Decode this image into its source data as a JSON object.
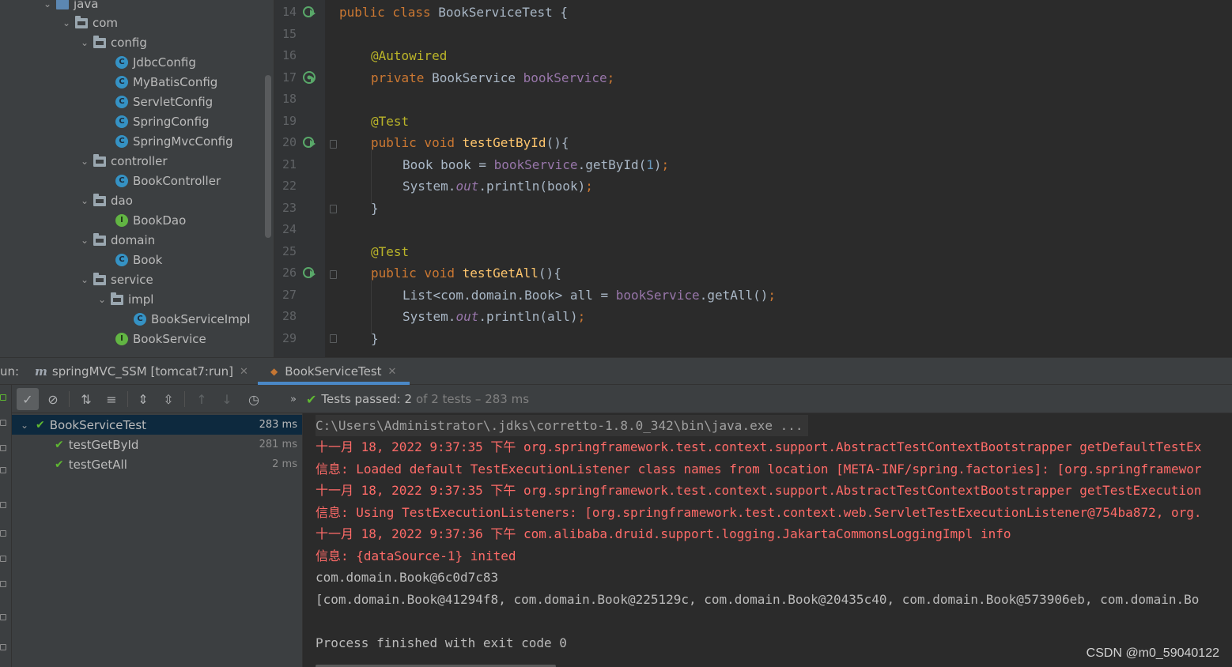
{
  "project_tree": {
    "items": [
      {
        "label": "java",
        "kind": "folder-src"
      },
      {
        "label": "com",
        "kind": "package"
      },
      {
        "label": "config",
        "kind": "package"
      },
      {
        "label": "JdbcConfig",
        "kind": "class"
      },
      {
        "label": "MyBatisConfig",
        "kind": "class"
      },
      {
        "label": "ServletConfig",
        "kind": "class"
      },
      {
        "label": "SpringConfig",
        "kind": "class"
      },
      {
        "label": "SpringMvcConfig",
        "kind": "class"
      },
      {
        "label": "controller",
        "kind": "package"
      },
      {
        "label": "BookController",
        "kind": "class"
      },
      {
        "label": "dao",
        "kind": "package"
      },
      {
        "label": "BookDao",
        "kind": "interface"
      },
      {
        "label": "domain",
        "kind": "package"
      },
      {
        "label": "Book",
        "kind": "class"
      },
      {
        "label": "service",
        "kind": "package"
      },
      {
        "label": "impl",
        "kind": "package"
      },
      {
        "label": "BookServiceImpl",
        "kind": "class"
      },
      {
        "label": "BookService",
        "kind": "interface"
      }
    ]
  },
  "editor": {
    "line_numbers": [
      "14",
      "15",
      "16",
      "17",
      "18",
      "19",
      "20",
      "21",
      "22",
      "23",
      "24",
      "25",
      "26",
      "27",
      "28",
      "29"
    ],
    "code": {
      "l14_kw": "public class ",
      "l14_name": "BookServiceTest {",
      "l16_ann": "@Autowired",
      "l17_kw": "private ",
      "l17_type": "BookService ",
      "l17_field": "bookService",
      "l17_semi": ";",
      "l19_ann": "@Test",
      "l20_kw": "public void ",
      "l20_fn": "testGetById",
      "l20_rest": "(){",
      "l21_a": "Book book = ",
      "l21_field": "bookService",
      "l21_b": ".getById(",
      "l21_num": "1",
      "l21_c": ")",
      "l21_semi": ";",
      "l22_a": "System.",
      "l22_out": "out",
      "l22_b": ".println(book)",
      "l22_semi": ";",
      "l23": "}",
      "l25_ann": "@Test",
      "l26_kw": "public void ",
      "l26_fn": "testGetAll",
      "l26_rest": "(){",
      "l27_a": "List<com.domain.Book> all = ",
      "l27_field": "bookService",
      "l27_b": ".getAll()",
      "l27_semi": ";",
      "l28_a": "System.",
      "l28_out": "out",
      "l28_b": ".println(all)",
      "l28_semi": ";",
      "l29": "}"
    }
  },
  "run_panel": {
    "label": "un:",
    "tabs": [
      {
        "label": "springMVC_SSM [tomcat7:run]",
        "icon": "maven-icon"
      },
      {
        "label": "BookServiceTest",
        "icon": "test-icon",
        "active": true
      }
    ],
    "status": {
      "main": "Tests passed: 2",
      "sub": "of 2 tests – 283 ms"
    },
    "tests": [
      {
        "name": "BookServiceTest",
        "duration": "283 ms",
        "selected": true
      },
      {
        "name": "testGetById",
        "duration": "281 ms"
      },
      {
        "name": "testGetAll",
        "duration": "2 ms"
      }
    ],
    "console": [
      {
        "text": "C:\\Users\\Administrator\\.jdks\\corretto-1.8.0_342\\bin\\java.exe ...",
        "kind": "cmd"
      },
      {
        "text": "十一月 18, 2022 9:37:35 下午 org.springframework.test.context.support.AbstractTestContextBootstrapper getDefaultTestEx",
        "kind": "err"
      },
      {
        "text": "信息: Loaded default TestExecutionListener class names from location [META-INF/spring.factories]: [org.springframewor",
        "kind": "err"
      },
      {
        "text": "十一月 18, 2022 9:37:35 下午 org.springframework.test.context.support.AbstractTestContextBootstrapper getTestExecution",
        "kind": "err"
      },
      {
        "text": "信息: Using TestExecutionListeners: [org.springframework.test.context.web.ServletTestExecutionListener@754ba872, org.",
        "kind": "err"
      },
      {
        "text": "十一月 18, 2022 9:37:36 下午 com.alibaba.druid.support.logging.JakartaCommonsLoggingImpl info",
        "kind": "err"
      },
      {
        "text": "信息: {dataSource-1} inited",
        "kind": "err"
      },
      {
        "text": "com.domain.Book@6c0d7c83",
        "kind": "out"
      },
      {
        "text": "[com.domain.Book@41294f8, com.domain.Book@225129c, com.domain.Book@20435c40, com.domain.Book@573906eb, com.domain.Bo",
        "kind": "out"
      },
      {
        "text": "",
        "kind": "out"
      },
      {
        "text": "Process finished with exit code 0",
        "kind": "out"
      }
    ]
  },
  "watermark": "CSDN @m0_59040122",
  "colors": {
    "pass_green": "#5fb832",
    "error_red": "#ff6b68",
    "keyword_orange": "#cc7832",
    "annotation_yellow": "#bbb529",
    "field_purple": "#9876aa",
    "method_yellow": "#ffc66d",
    "accent_blue": "#4a88c7"
  }
}
